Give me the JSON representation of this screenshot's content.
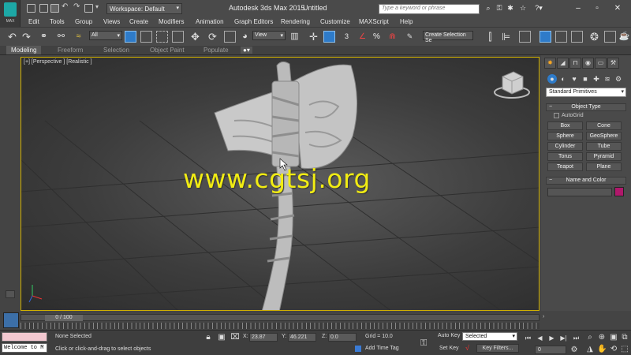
{
  "app": {
    "title": "Autodesk 3ds Max  2015",
    "document": "Untitled",
    "logo_label": "MAX",
    "workspace": "Workspace: Default",
    "search_placeholder": "Type a keyword or phrase"
  },
  "menu": [
    "Edit",
    "Tools",
    "Group",
    "Views",
    "Create",
    "Modifiers",
    "Animation",
    "Graph Editors",
    "Rendering",
    "Customize",
    "MAXScript",
    "Help"
  ],
  "toolbar": {
    "selection_filter": "All",
    "reference_coord": "View",
    "selection_set": "Create Selection Se",
    "snap_number": "3",
    "angle_snap": "∠",
    "percent_snap": "%"
  },
  "ribbon": {
    "tabs": [
      "Modeling",
      "Freeform",
      "Selection",
      "Object Paint",
      "Populate"
    ],
    "active": "Modeling"
  },
  "viewport": {
    "label": "[+] [Perspective ] [Realistic ]",
    "watermark": "www.cgtsj.org"
  },
  "command_panel": {
    "category": "Standard Primitives",
    "object_type_title": "Object Type",
    "autogrid_label": "AutoGrid",
    "autogrid_checked": false,
    "primitives": [
      "Box",
      "Cone",
      "Sphere",
      "GeoSphere",
      "Cylinder",
      "Tube",
      "Torus",
      "Pyramid",
      "Teapot",
      "Plane"
    ],
    "name_color_title": "Name and Color",
    "object_color": "#b0186b"
  },
  "timeline": {
    "frame_label": "0 / 100"
  },
  "status": {
    "maxscript_text": "Welcome to M",
    "selection_status": "None Selected",
    "prompt": "Click or click-and-drag to select objects",
    "x_label": "X:",
    "x_value": "23.87",
    "y_label": "Y:",
    "y_value": "46.221",
    "z_label": "Z:",
    "z_value": "0.0",
    "grid": "Grid = 10.0",
    "add_time_tag": "Add Time Tag",
    "auto_key": "Auto Key",
    "set_key": "Set Key",
    "selected_option": "Selected",
    "key_filters": "Key Filters...",
    "current_frame": "0"
  }
}
